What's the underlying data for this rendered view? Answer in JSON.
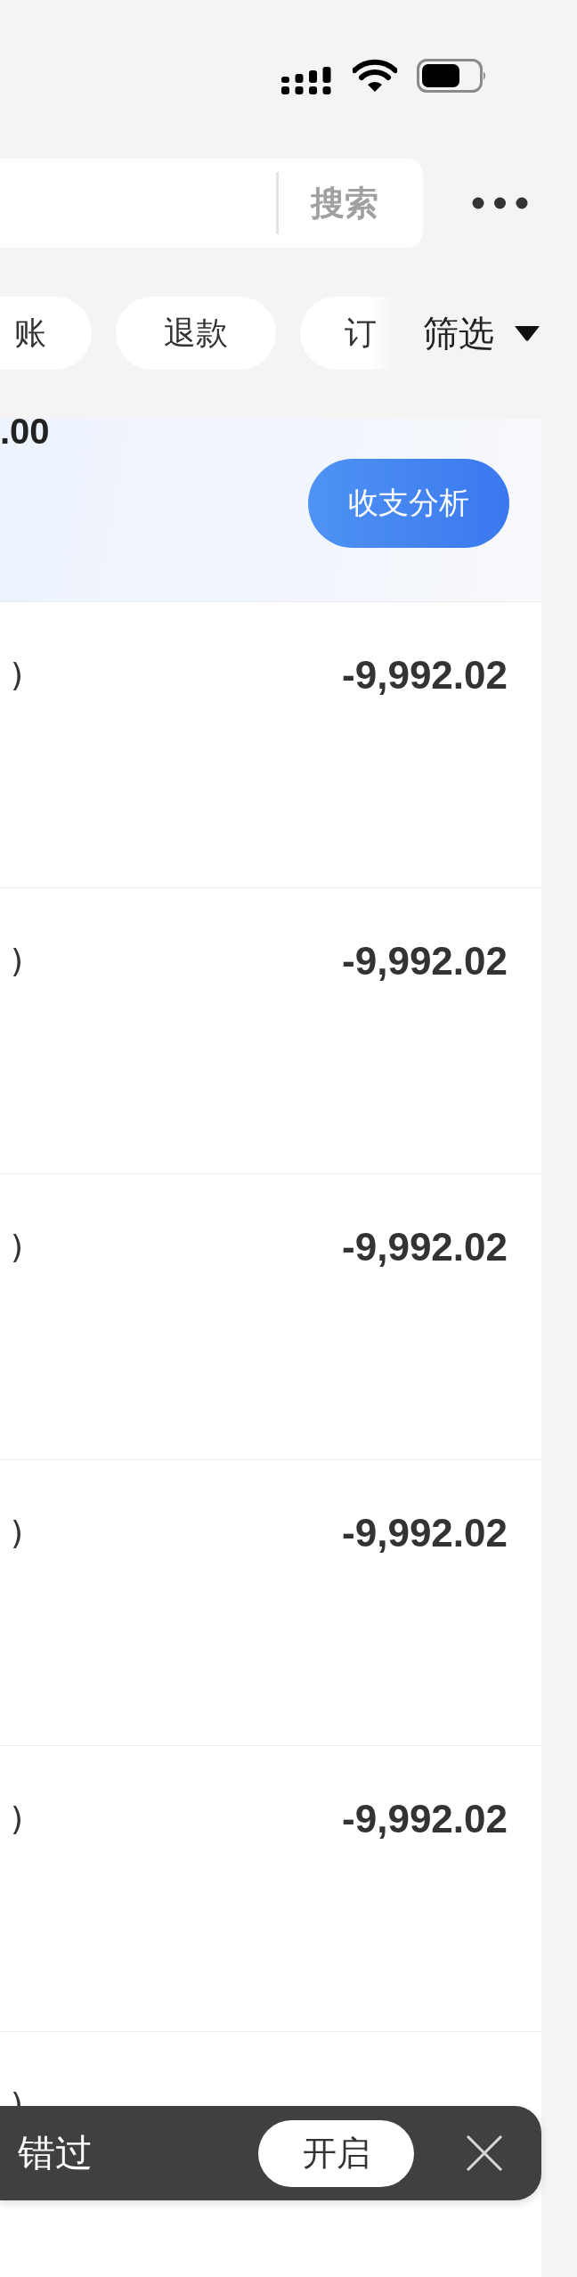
{
  "search_bar": {
    "button": "搜索"
  },
  "filter_chips": [
    {
      "label": "账",
      "selected": false
    },
    {
      "label": "退款",
      "selected": false
    },
    {
      "label": "订",
      "selected": false
    }
  ],
  "filter_button": {
    "label": "筛选"
  },
  "summary": {
    "amount": ".00",
    "button": "收支分析"
  },
  "transactions": [
    {
      "note": ")",
      "amount": "-9,992.02"
    },
    {
      "note": ")",
      "amount": "-9,992.02"
    },
    {
      "note": ")",
      "amount": "-9,992.02"
    },
    {
      "note": ")",
      "amount": "-9,992.02"
    },
    {
      "note": ")",
      "amount": "-9,992.02"
    },
    {
      "note": ")"
    }
  ],
  "notification_banner": {
    "text": "错过",
    "button": "开启"
  }
}
